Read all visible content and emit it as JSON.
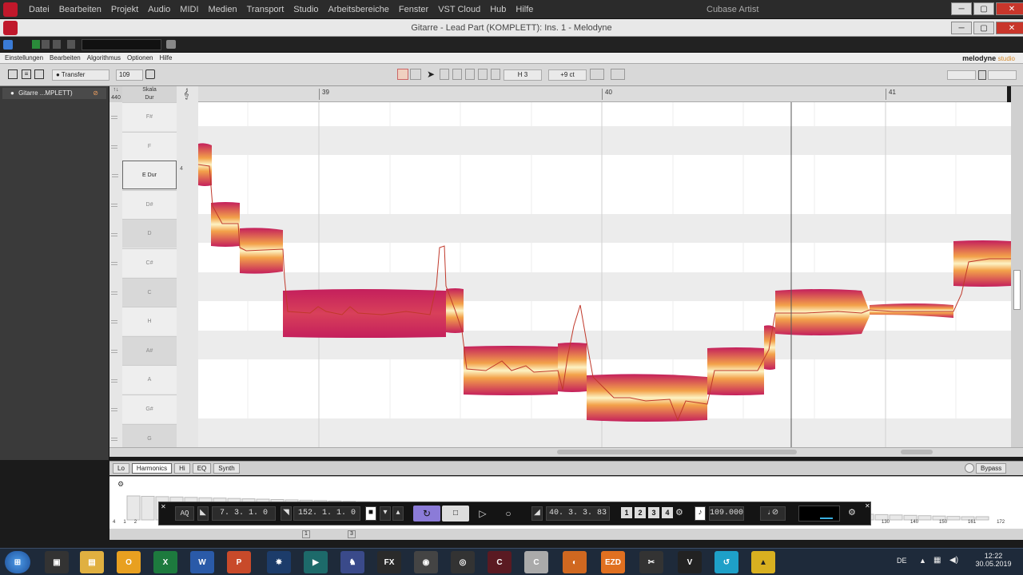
{
  "host": {
    "menu": [
      "Datei",
      "Bearbeiten",
      "Projekt",
      "Audio",
      "MIDI",
      "Medien",
      "Transport",
      "Studio",
      "Arbeitsbereiche",
      "Fenster",
      "VST Cloud",
      "Hub",
      "Hilfe"
    ],
    "app_title": "Cubase Artist",
    "plugin_title": "Gitarre - Lead Part (KOMPLETT): Ins. 1 - Melodyne"
  },
  "melodyne": {
    "menu": [
      "Einstellungen",
      "Bearbeiten",
      "Algorithmus",
      "Optionen",
      "Hilfe"
    ],
    "brand": "melodyne",
    "brand_sub": "studio",
    "transfer_label": "Transfer",
    "tempo_value": "109",
    "pitch_note": "H 3",
    "pitch_cents": "+9 ct",
    "track_name": "Gitarre ...MPLETT)",
    "scale_header": "Skala",
    "scale_sub": "Dur",
    "ref_pitch": "440",
    "scale_key": "E Dur",
    "scale_key_num": "4",
    "note_names": [
      "F#",
      "F",
      "E Dur",
      "D#",
      "D",
      "C#",
      "C",
      "H",
      "A#",
      "A",
      "G#",
      "G"
    ],
    "bars": [
      "39",
      "40",
      "41"
    ]
  },
  "harmonics": {
    "tabs": [
      "Lo",
      "Harmonics",
      "Hi",
      "EQ",
      "Synth"
    ],
    "active_tab": "Harmonics",
    "bypass": "Bypass",
    "axis_left": [
      "4",
      "1",
      "2"
    ],
    "axis_right": [
      "130",
      "140",
      "150",
      "161",
      "172"
    ],
    "footer_num": "1",
    "footer_num2": "3"
  },
  "transport": {
    "aq": "AQ",
    "left_locator": "7. 3. 1.   0",
    "right_locator": "152. 1. 1.   0",
    "position": "40. 3. 3. 83",
    "tempo": "109.000",
    "marker_nums": [
      "1",
      "2",
      "3",
      "4"
    ]
  },
  "taskbar": {
    "lang": "DE",
    "time": "12:22",
    "date": "30.05.2019"
  },
  "colors": {
    "cubase_red": "#c0182b",
    "blob_light": "#fdf3c4",
    "blob_dark": "#c41f5c",
    "transport_accent": "#8b7bd8"
  }
}
